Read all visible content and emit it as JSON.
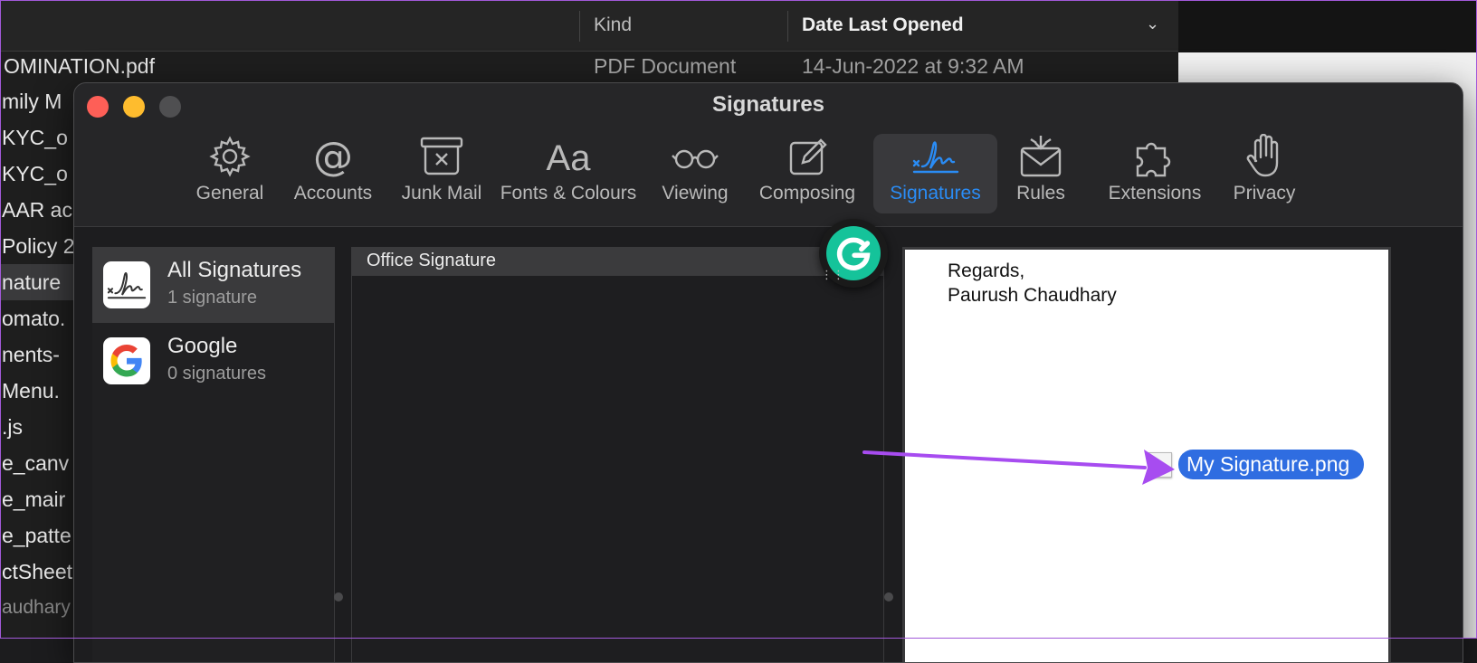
{
  "finder": {
    "col_kind": "Kind",
    "col_date": "Date Last Opened",
    "row0": {
      "name": "OMINATION.pdf",
      "kind": "PDF Document",
      "date": "14-Jun-2022 at 9:32 AM"
    },
    "items": [
      "mily M",
      "KYC_o",
      "KYC_o",
      "AAR ac",
      "Policy 2",
      "nature",
      "omato.",
      "nents-",
      "Menu.",
      ".js",
      "e_canv",
      "e_mair",
      "e_patte",
      "ctSheet"
    ],
    "user_label": "audhary"
  },
  "window": {
    "title": "Signatures"
  },
  "toolbar": {
    "general": "General",
    "accounts": "Accounts",
    "junk": "Junk Mail",
    "fonts": "Fonts & Colours",
    "viewing": "Viewing",
    "composing": "Composing",
    "signatures": "Signatures",
    "rules": "Rules",
    "extensions": "Extensions",
    "privacy": "Privacy"
  },
  "accounts": [
    {
      "name": "All Signatures",
      "count": "1 signature"
    },
    {
      "name": "Google",
      "count": "0 signatures"
    }
  ],
  "signatures": {
    "selected": "Office Signature"
  },
  "preview": {
    "line1": "Regards,",
    "line2": "Paurush Chaudhary",
    "file": "My Signature.png"
  },
  "colors": {
    "accent": "#2a8cf5",
    "file_label": "#2f6de1",
    "arrow": "#a74cf0",
    "grammarly": "#15c39a"
  },
  "icons": {
    "grammarly": "grammarly-g-icon",
    "arrow": "annotation-arrow"
  }
}
